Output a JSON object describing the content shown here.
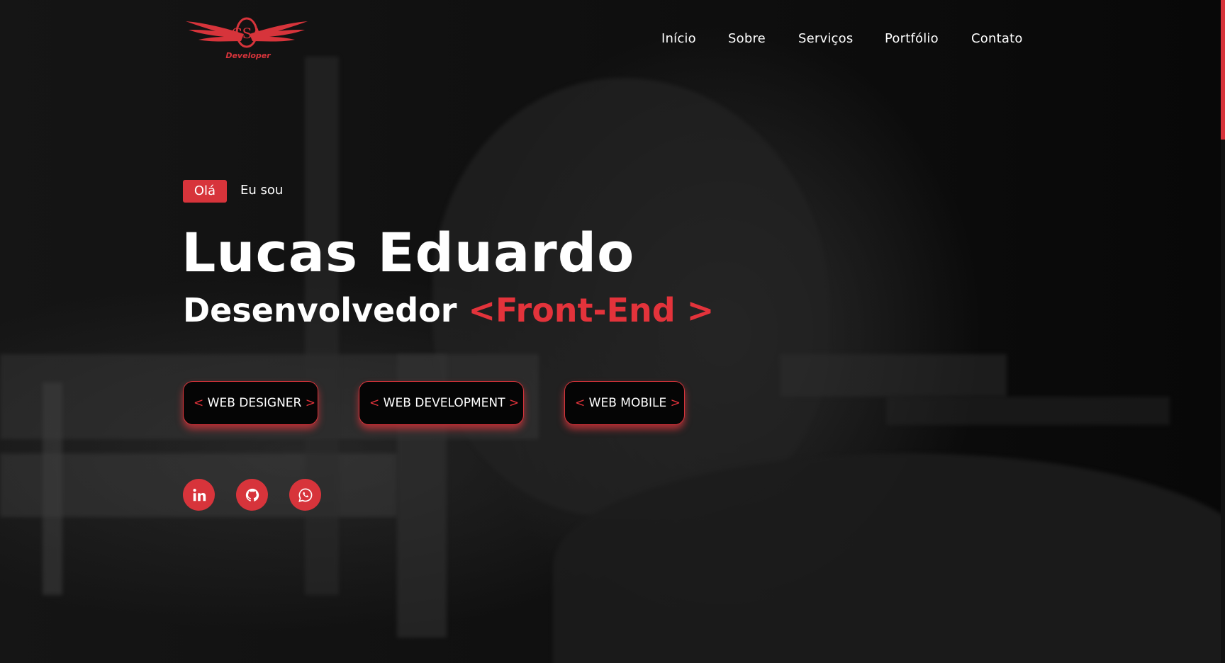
{
  "brand": {
    "logo_text": "Developer",
    "monogram": "CSA",
    "accent_color": "#d7343b"
  },
  "nav": {
    "items": [
      {
        "label": "Início"
      },
      {
        "label": "Sobre"
      },
      {
        "label": "Serviços"
      },
      {
        "label": "Portfólio"
      },
      {
        "label": "Contato"
      }
    ]
  },
  "hero": {
    "greeting_badge": "Olá",
    "greeting_text": "Eu sou",
    "name": "Lucas Eduardo",
    "role_plain": "Desenvolvedor",
    "role_accent": "<Front-End >",
    "skills": [
      {
        "label": "WEB DESIGNER",
        "open": "<",
        "close": ">"
      },
      {
        "label": "WEB DEVELOPMENT",
        "open": "<",
        "close": ">"
      },
      {
        "label": "WEB MOBILE",
        "open": "<",
        "close": ">"
      }
    ],
    "social": [
      {
        "icon": "linkedin-icon"
      },
      {
        "icon": "github-icon"
      },
      {
        "icon": "whatsapp-icon"
      }
    ]
  }
}
